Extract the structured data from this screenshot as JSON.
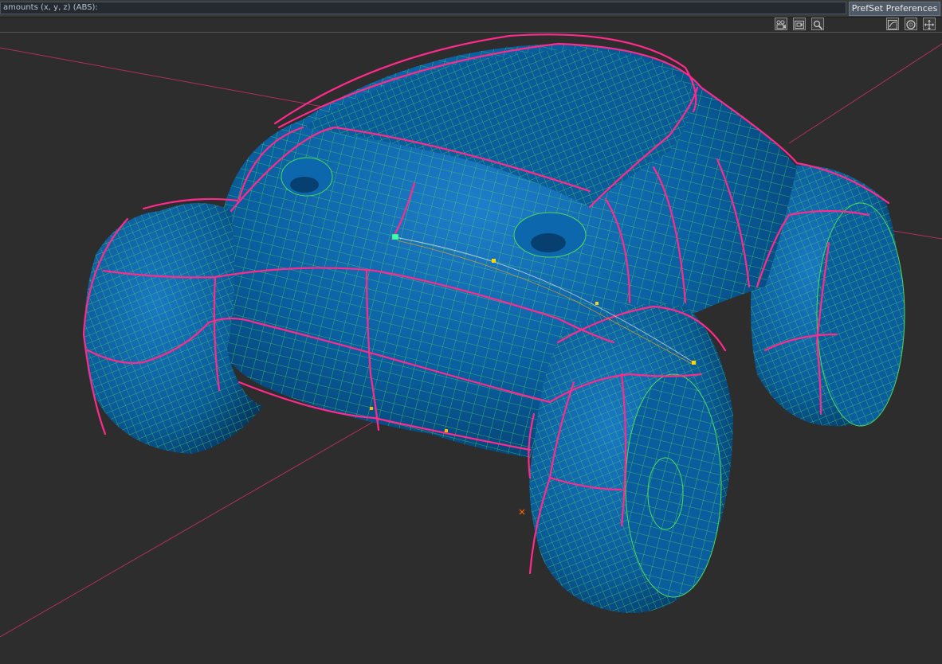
{
  "command_bar": {
    "prompt_text": "amounts (x, y, z) (ABS):",
    "prefset_label": "PrefSet Preferences"
  },
  "viewport_toolbar": {
    "left_group": [
      "camera-icon",
      "camera-frame-icon",
      "zoom-magnifier-icon"
    ],
    "right_group": [
      "view-fit-icon",
      "rotate-view-icon",
      "pan-move-icon"
    ]
  },
  "viewport": {
    "background_color": "#2d2d2d",
    "model_fill_color": "#0a5fa0",
    "wireframe_color": "#4ddb5a",
    "curve_color": "#ff2a8c",
    "axis_color": "#b0305a"
  }
}
